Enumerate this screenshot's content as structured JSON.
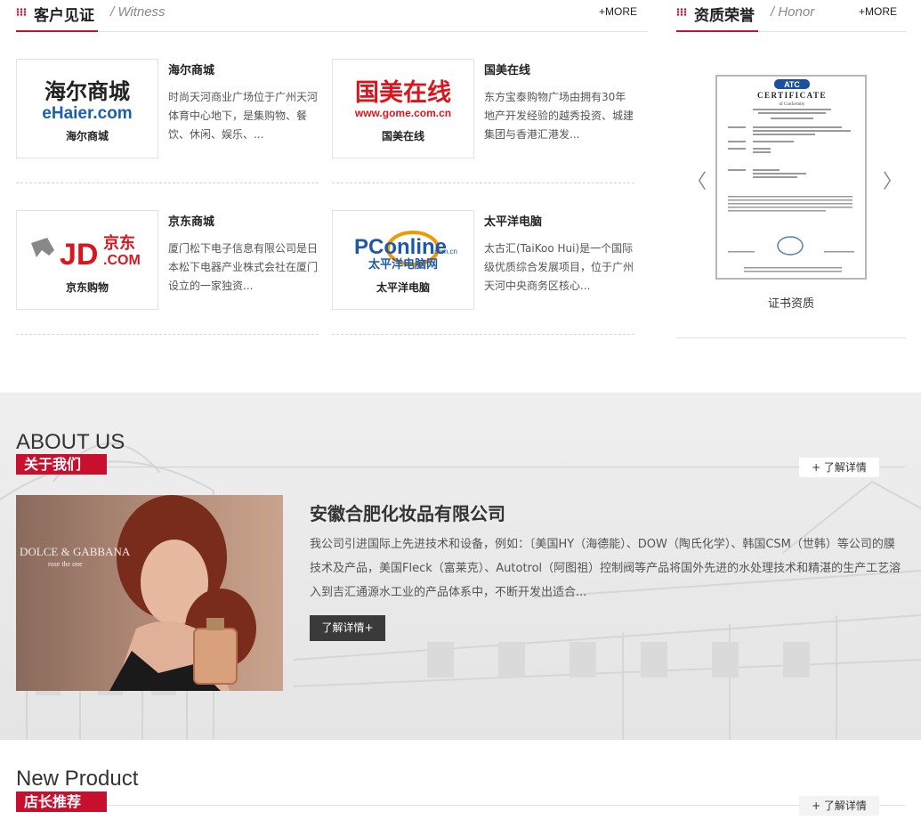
{
  "witness": {
    "title": "客户见证",
    "subtitle": "/ Witness",
    "more": "+MORE",
    "items": [
      {
        "name": "海尔商城",
        "logo_text_cn": "海尔商城",
        "logo_text_en": "eHaier.com",
        "caption": "海尔商城",
        "desc": "时尚天河商业广场位于广州天河体育中心地下，是集购物、餐饮、休闲、娱乐、..."
      },
      {
        "name": "国美在线",
        "logo_text_cn": "国美在线",
        "logo_text_en": "www.gome.com.cn",
        "caption": "国美在线",
        "desc": "东方宝泰购物广场由拥有30年地产开发经验的越秀投资、城建集团与香港汇港发..."
      },
      {
        "name": "京东商城",
        "logo_text_cn": "京东",
        "logo_text_en": "JD",
        "logo_text_com": ".COM",
        "caption": "京东购物",
        "desc": "厦门松下电子信息有限公司是日本松下电器产业株式会社在厦门设立的一家独资..."
      },
      {
        "name": "太平洋电脑",
        "logo_text_cn": "太平洋电脑网",
        "logo_text_en": "PConline",
        "logo_text_com": ".com.cn",
        "caption": "太平洋电脑",
        "desc": "太古汇(TaiKoo Hui)是一个国际级优质综合发展项目，位于广州天河中央商务区核心..."
      }
    ]
  },
  "honor": {
    "title": "资质荣誉",
    "subtitle": "/ Honor",
    "more": "+MORE",
    "cert_caption": "证书资质",
    "cert_brand": "ATC",
    "cert_heading": "CERTIFICATE",
    "cert_sub": "of Conformity",
    "arrow_prev": "〈",
    "arrow_next": "〉"
  },
  "about": {
    "en": "ABOUT US",
    "cn": "关于我们",
    "detail_btn": "+ 了解详情",
    "company": "安徽合肥化妆品有限公司",
    "text": "我公司引进国际上先进技术和设备，例如：〔美国HY（海德能）、DOW（陶氏化学）、韩国CSM（世韩）等公司的膜技术及产品，美国Fleck（富莱克）、Autotrol（阿图祖）控制阀等产品将国外先进的水处理技术和精湛的生产工艺溶入到吉汇通源水工业的产品体系中，不断开发出适合...",
    "more_btn": "了解详情+",
    "image_brand": "DOLCE & GABBANA",
    "image_sub": "rose the one"
  },
  "new_product": {
    "en": "New Product",
    "cn": "店长推荐",
    "detail_btn": "+ 了解详情"
  },
  "colors": {
    "accent": "#c8102e",
    "dark_btn": "#3a3a3a"
  }
}
